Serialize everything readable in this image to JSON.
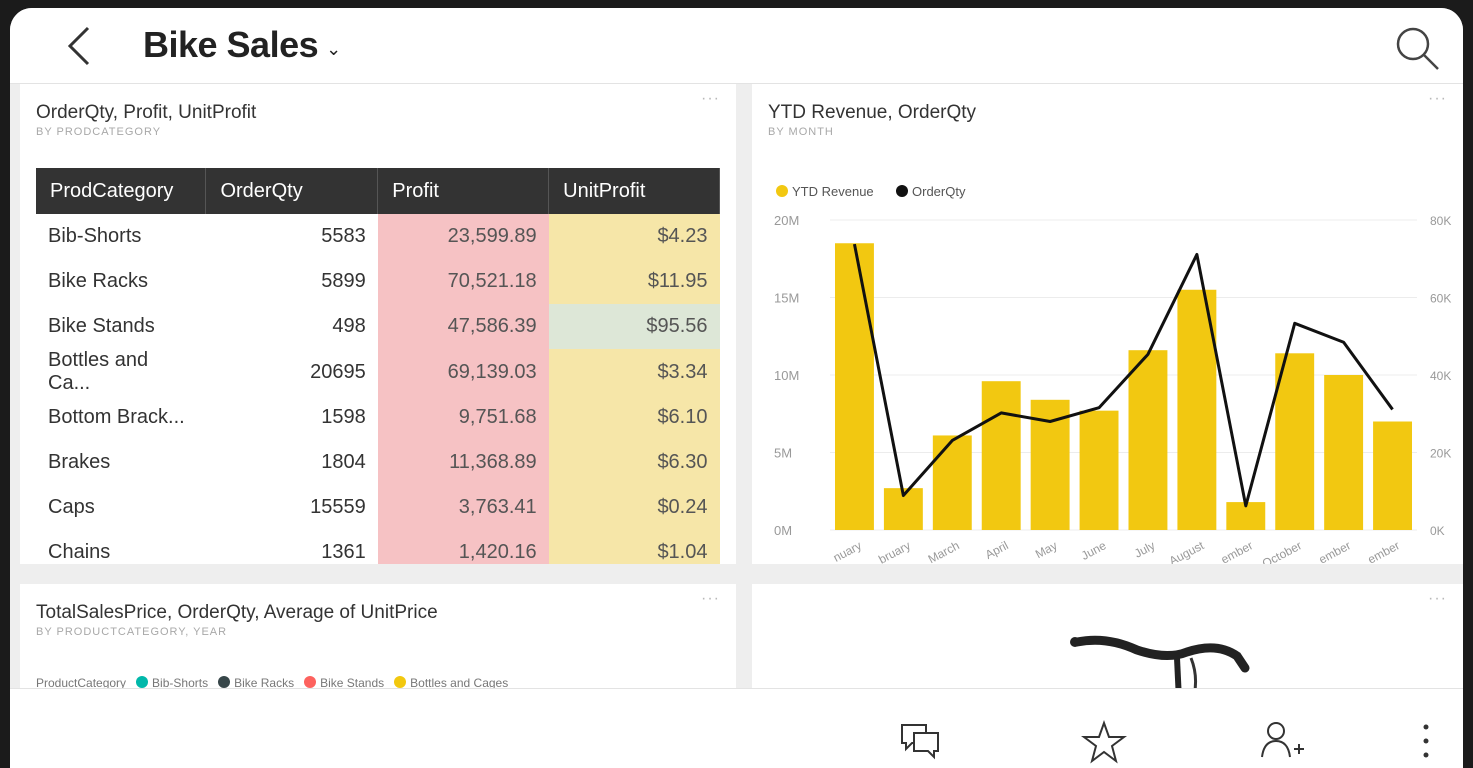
{
  "header": {
    "title": "Bike Sales",
    "title_chevron": "⌄",
    "back_icon": "chevron-left-icon",
    "search_icon": "search-icon"
  },
  "tiles": {
    "more_label": "···",
    "table_tile": {
      "title": "OrderQty, Profit, UnitProfit",
      "subtitle": "BY PRODCATEGORY",
      "columns": [
        "ProdCategory",
        "OrderQty",
        "Profit",
        "UnitProfit"
      ],
      "rows": [
        {
          "category": "Bib-Shorts",
          "qty": "5583",
          "profit": "23,599.89",
          "unit": "$4.23"
        },
        {
          "category": "Bike Racks",
          "qty": "5899",
          "profit": "70,521.18",
          "unit": "$11.95"
        },
        {
          "category": "Bike Stands",
          "qty": "498",
          "profit": "47,586.39",
          "unit": "$95.56"
        },
        {
          "category": "Bottles and Ca...",
          "qty": "20695",
          "profit": "69,139.03",
          "unit": "$3.34"
        },
        {
          "category": "Bottom Brack...",
          "qty": "1598",
          "profit": "9,751.68",
          "unit": "$6.10"
        },
        {
          "category": "Brakes",
          "qty": "1804",
          "profit": "11,368.89",
          "unit": "$6.30"
        },
        {
          "category": "Caps",
          "qty": "15559",
          "profit": "3,763.41",
          "unit": "$0.24"
        },
        {
          "category": "Chains",
          "qty": "1361",
          "profit": "1,420.16",
          "unit": "$1.04"
        }
      ]
    },
    "chart_tile": {
      "title": "YTD Revenue, OrderQty",
      "subtitle": "BY MONTH"
    },
    "sales_tile": {
      "title": "TotalSalesPrice, OrderQty, Average of UnitPrice",
      "subtitle": "BY PRODUCTCATEGORY, YEAR",
      "legend_title": "ProductCategory",
      "legend": [
        {
          "name": "Bib-Shorts",
          "color": "#01b8aa"
        },
        {
          "name": "Bike Racks",
          "color": "#374649"
        },
        {
          "name": "Bike Stands",
          "color": "#fd625e"
        },
        {
          "name": "Bottles and Cages",
          "color": "#f2c80f"
        }
      ]
    },
    "image_tile": {
      "image_icon": "bike-handlebar-image"
    }
  },
  "chart_data": {
    "type": "bar",
    "title": "YTD Revenue, OrderQty",
    "subtitle": "BY MONTH",
    "categories": [
      "January",
      "February",
      "March",
      "April",
      "May",
      "June",
      "July",
      "August",
      "September",
      "October",
      "November",
      "December"
    ],
    "tick_labels": [
      "nuary",
      "bruary",
      "March",
      "April",
      "May",
      "June",
      "July",
      "August",
      "ember",
      "October",
      "ember",
      "ember"
    ],
    "series": [
      {
        "name": "YTD Revenue",
        "type": "bar",
        "axis": "left",
        "color": "#f2c811",
        "values": [
          18.5,
          2.7,
          6.1,
          9.6,
          8.4,
          7.7,
          11.6,
          15.5,
          1.8,
          11.4,
          10.0,
          7.0
        ]
      },
      {
        "name": "OrderQty",
        "type": "line",
        "axis": "right",
        "color": "#111111",
        "values": [
          83000,
          10000,
          26000,
          34000,
          31500,
          35500,
          51000,
          80000,
          7000,
          60000,
          54500,
          35000
        ]
      }
    ],
    "y_left": {
      "ticks": [
        "0M",
        "5M",
        "10M",
        "15M",
        "20M"
      ],
      "ylim": [
        0,
        20
      ]
    },
    "y_right": {
      "ticks": [
        "0K",
        "20K",
        "40K",
        "60K",
        "80K"
      ],
      "ylim": [
        0,
        90000
      ]
    },
    "legend_position": "top-left",
    "grid": true
  },
  "bottom_bar": {
    "icons": [
      "comments-icon",
      "favorite-star-icon",
      "invite-user-icon",
      "more-options-icon"
    ]
  }
}
